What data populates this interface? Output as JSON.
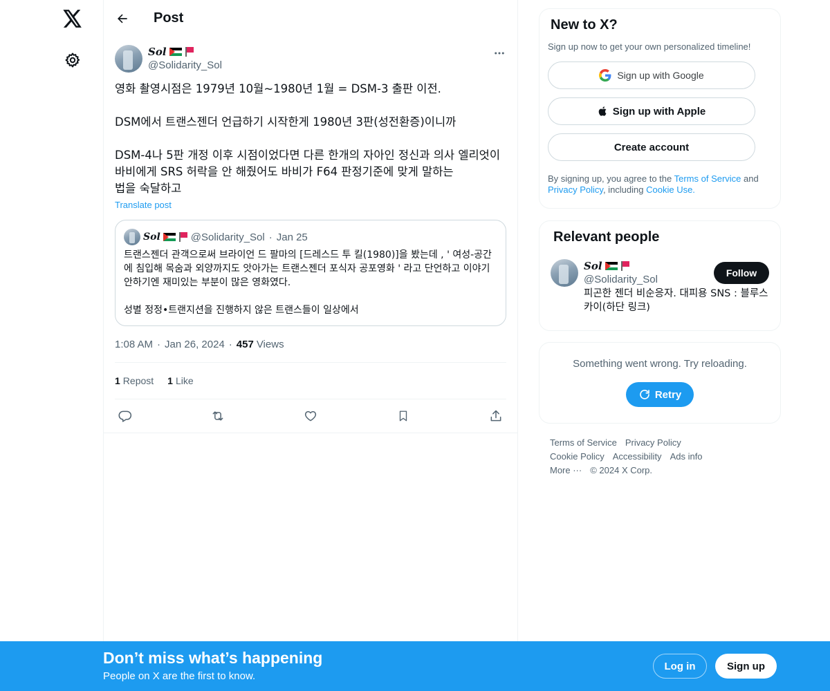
{
  "nav": {
    "logo_icon": "x-logo-icon",
    "settings_icon": "gear-icon"
  },
  "header": {
    "title": "Post"
  },
  "post": {
    "author": {
      "display_name": "Sol",
      "handle": "@Solidarity_Sol"
    },
    "text": "영화 촬영시점은 1979년 10월~1980년 1월 = DSM-3 출판 이전.\n\nDSM에서 트랜스젠더 언급하기 시작한게 1980년 3판(성전환증)이니까\n\nDSM-4나 5판 개정 이후 시점이었다면 다른 한개의 자아인 정신과 의사 엘리엇이 바비에게 SRS 허락을 안 해줬어도 바비가 F64 판정기준에 맞게 말하는\n법을 숙달하고",
    "translate_label": "Translate post",
    "quote": {
      "display_name": "Sol",
      "handle": "@Solidarity_Sol",
      "date": "Jan 25",
      "text": "트랜스젠더 관객으로써 브라이언 드 팔마의 [드레스드 투 킬(1980)]을 봤는데 , ' 여성-공간에 침입해 목숨과 외양까지도 앗아가는 트랜스젠더 포식자 공포영화 ' 라고 단언하고 이야기 안하기엔 재미있는 부분이 많은 영화였다.\n\n성별 정정•트랜지션을 진행하지 않은 트랜스들이 일상에서"
    },
    "time": "1:08 AM",
    "date": "Jan 26, 2024",
    "views_count": "457",
    "views_label": "Views",
    "reposts_count": "1",
    "reposts_label": "Repost",
    "likes_count": "1",
    "likes_label": "Like"
  },
  "signup": {
    "title": "New to X?",
    "subtitle": "Sign up now to get your own personalized timeline!",
    "google_label": "Sign up with Google",
    "apple_label": "Sign up with Apple",
    "create_label": "Create account",
    "legal_prefix": "By signing up, you agree to the ",
    "terms_link": "Terms of Service",
    "legal_and": " and ",
    "privacy_link": "Privacy Policy",
    "legal_including": ", including ",
    "cookie_link": "Cookie Use."
  },
  "relevant": {
    "title": "Relevant people",
    "person": {
      "display_name": "Sol",
      "handle": "@Solidarity_Sol",
      "bio": "피곤한 젠더 비순응자. 대피용 SNS : 블루스카이(하단 링크)",
      "follow_label": "Follow"
    }
  },
  "error_card": {
    "message": "Something went wrong. Try reloading.",
    "retry_label": "Retry"
  },
  "footer": {
    "links": [
      "Terms of Service",
      "Privacy Policy",
      "Cookie Policy",
      "Accessibility",
      "Ads info",
      "More ···",
      "© 2024 X Corp."
    ]
  },
  "banner": {
    "title": "Don’t miss what’s happening",
    "subtitle": "People on X are the first to know.",
    "login_label": "Log in",
    "signup_label": "Sign up"
  },
  "colors": {
    "accent": "#1d9bf0",
    "text_primary": "#0f1419",
    "text_secondary": "#536471",
    "border": "#eff3f4"
  }
}
